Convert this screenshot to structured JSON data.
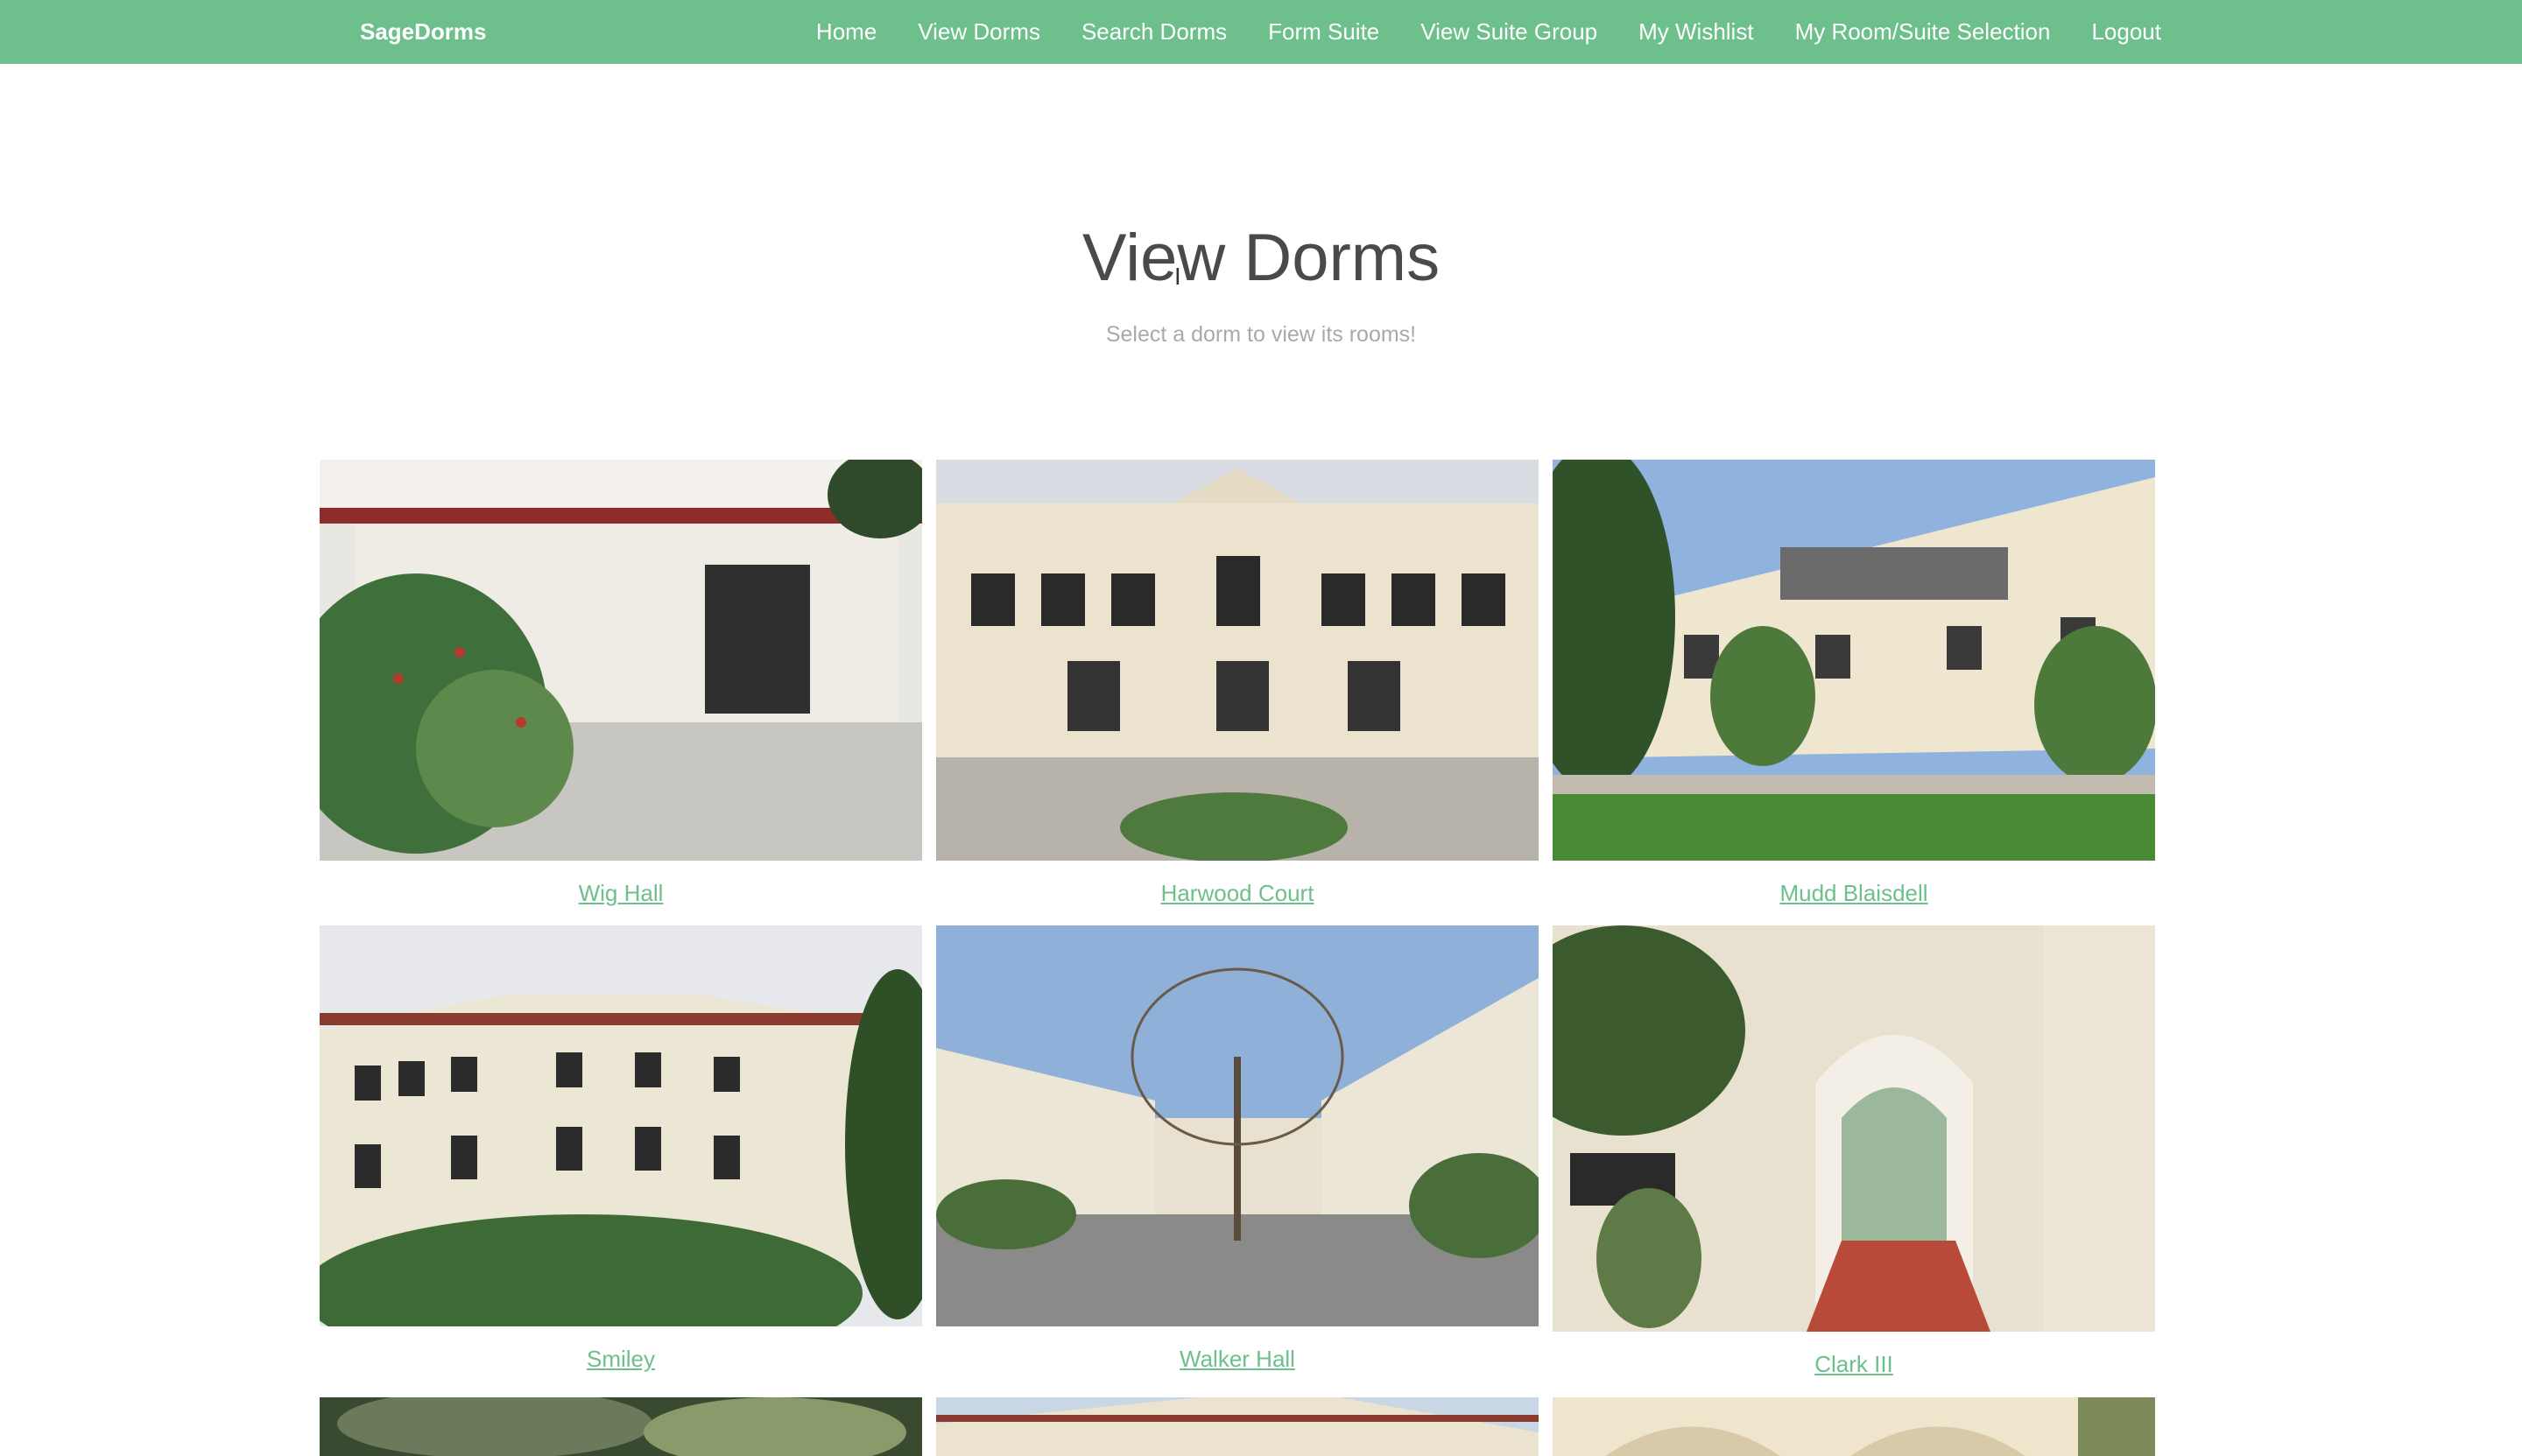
{
  "navbar": {
    "brand": "SageDorms",
    "links": [
      {
        "label": "Home"
      },
      {
        "label": "View Dorms"
      },
      {
        "label": "Search Dorms"
      },
      {
        "label": "Form Suite"
      },
      {
        "label": "View Suite Group"
      },
      {
        "label": "My Wishlist"
      },
      {
        "label": "My Room/Suite Selection"
      },
      {
        "label": "Logout"
      }
    ],
    "color": "#6dbf8c"
  },
  "header": {
    "title": "View Dorms",
    "subtitle": "Select a dorm to view its rooms!"
  },
  "dorms": [
    {
      "name": "Wig Hall"
    },
    {
      "name": "Harwood Court"
    },
    {
      "name": "Mudd Blaisdell"
    },
    {
      "name": "Smiley"
    },
    {
      "name": "Walker Hall"
    },
    {
      "name": "Clark III"
    }
  ],
  "cursor_icon": "text-cursor-icon"
}
